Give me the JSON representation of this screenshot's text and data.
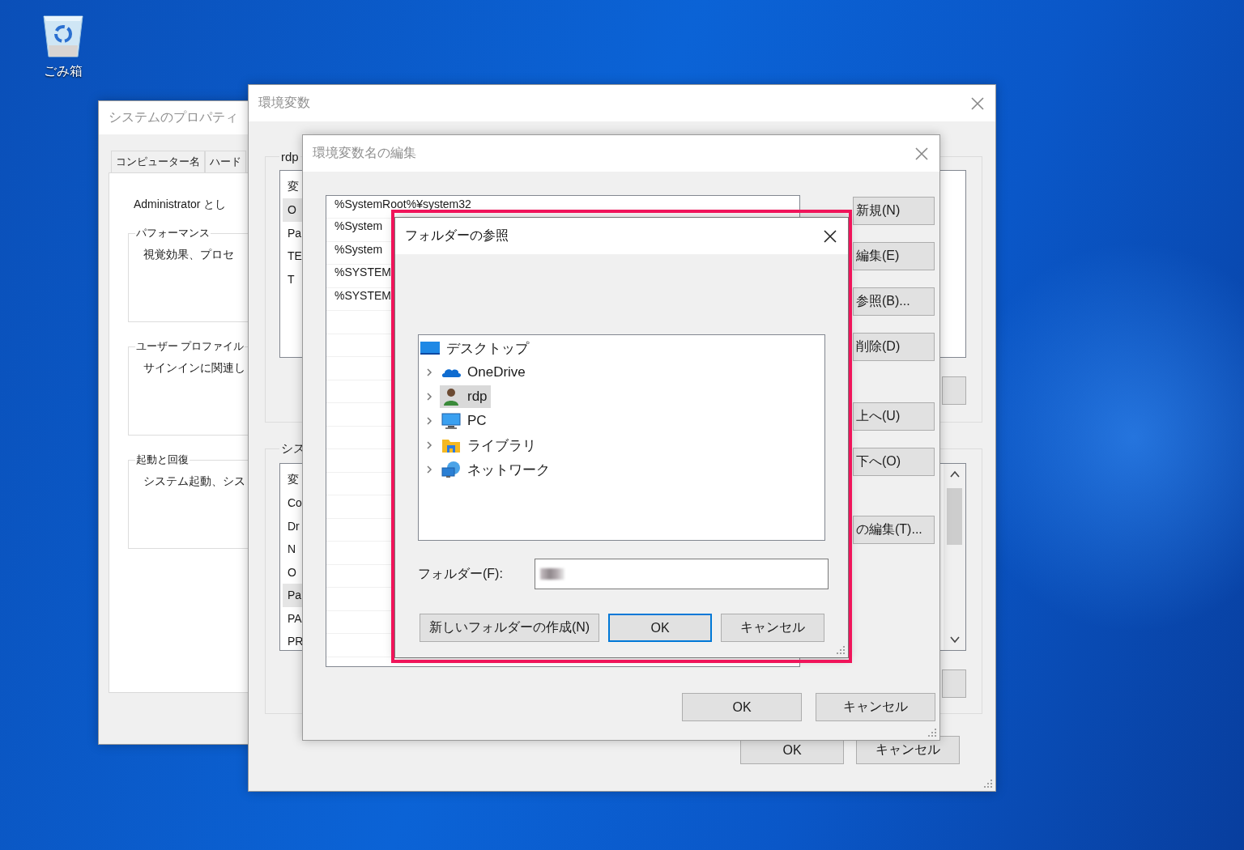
{
  "desktop": {
    "icons": [
      {
        "label": "ごみ箱",
        "kind": "recycle-bin"
      }
    ]
  },
  "system_properties": {
    "title": "システムのプロパティ",
    "tabs": [
      {
        "label": "コンピューター名",
        "selected": false
      },
      {
        "label": "ハード",
        "selected": false
      }
    ],
    "intro": "Administrator とし",
    "groups": [
      {
        "label": "パフォーマンス",
        "text": "視覚効果、プロセ"
      },
      {
        "label": "ユーザー プロファイル",
        "text": "サインインに関連し"
      },
      {
        "label": "起動と回復",
        "text": "システム起動、シス"
      }
    ]
  },
  "environment_variables": {
    "title": "環境変数",
    "user_group": {
      "label": "rdp",
      "header": "変",
      "rows": [
        {
          "text": "O",
          "selected": true
        },
        {
          "text": "Pa",
          "selected": false
        },
        {
          "text": "TE",
          "selected": false
        },
        {
          "text": "T",
          "selected": false
        }
      ]
    },
    "system_group": {
      "label": "シス",
      "header": "変",
      "rows": [
        {
          "text": "Co",
          "selected": false
        },
        {
          "text": "Dr",
          "selected": false
        },
        {
          "text": "N",
          "selected": false
        },
        {
          "text": "O",
          "selected": false
        },
        {
          "text": "Pa",
          "selected": true
        },
        {
          "text": "PA",
          "selected": false
        },
        {
          "text": "PR",
          "selected": false
        }
      ]
    },
    "buttons": [
      "OK",
      "キャンセル"
    ]
  },
  "edit_variable": {
    "title": "環境変数名の編集",
    "values": [
      "%SystemRoot%¥system32",
      "%System",
      "%System",
      "%SYSTEM",
      "%SYSTEM"
    ],
    "side_buttons": [
      "新規(N)",
      "編集(E)",
      "参照(B)...",
      "削除(D)",
      "上へ(U)",
      "下へ(O)",
      "の編集(T)..."
    ],
    "buttons": [
      "OK",
      "キャンセル"
    ]
  },
  "browse_folder": {
    "title": "フォルダーの参照",
    "tree": [
      {
        "label": "デスクトップ",
        "kind": "desktop",
        "selected": false,
        "children": [
          {
            "label": "OneDrive",
            "kind": "cloud",
            "selected": false,
            "expanded": false
          },
          {
            "label": "rdp",
            "kind": "user",
            "selected": true,
            "expanded": false
          },
          {
            "label": "PC",
            "kind": "pc",
            "selected": false,
            "expanded": false
          },
          {
            "label": "ライブラリ",
            "kind": "library",
            "selected": false,
            "expanded": false
          },
          {
            "label": "ネットワーク",
            "kind": "network",
            "selected": false,
            "expanded": false
          }
        ]
      }
    ],
    "folder_label": "フォルダー(F):",
    "buttons": [
      {
        "label": "新しいフォルダーの作成(N)",
        "default": false
      },
      {
        "label": "OK",
        "default": true
      },
      {
        "label": "キャンセル",
        "default": false
      }
    ]
  }
}
